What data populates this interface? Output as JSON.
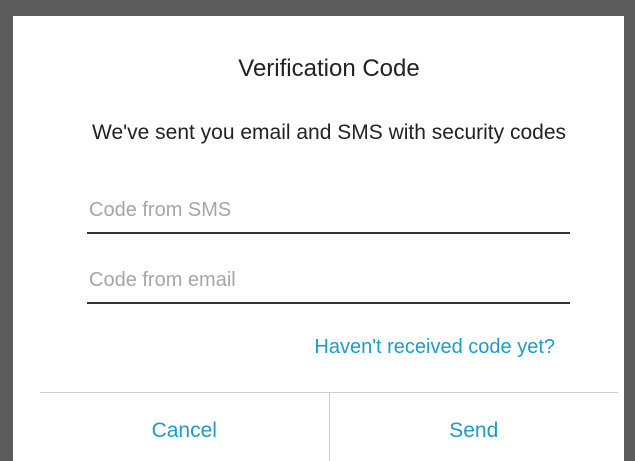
{
  "dialog": {
    "title": "Verification Code",
    "message": "We've sent you email and SMS with security codes",
    "sms_field": {
      "placeholder": "Code from SMS",
      "value": ""
    },
    "email_field": {
      "placeholder": "Code from email",
      "value": ""
    },
    "resend_link": "Haven't received code yet?",
    "cancel_label": "Cancel",
    "send_label": "Send"
  },
  "colors": {
    "accent": "#1e9bc9",
    "backdrop": "#5c5c5c",
    "text": "#222222",
    "placeholder": "#a6a6a6"
  }
}
